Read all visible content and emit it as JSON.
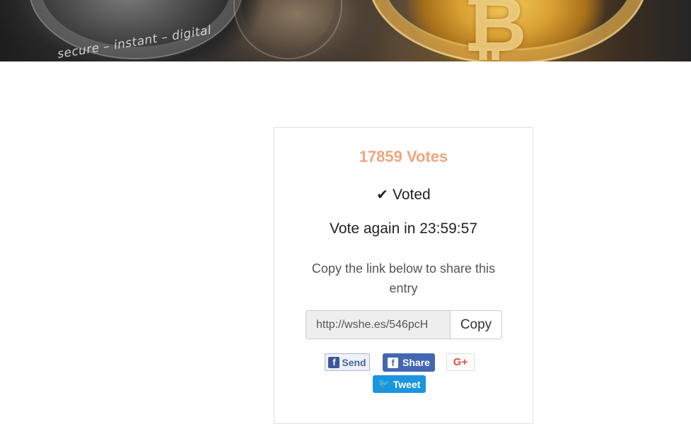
{
  "banner": {
    "coin_text": "secure – instant – digital"
  },
  "vote_card": {
    "votes": "17859 Votes",
    "voted_label": "Voted",
    "countdown": "Vote again in 23:59:57",
    "share_text": "Copy the link below to share this entry",
    "link_value": "http://wshe.es/546pcH",
    "copy_label": "Copy"
  },
  "social": {
    "fb_send_label": "Send",
    "fb_share_label": "Share",
    "gplus_label": "G+",
    "tweet_label": "Tweet"
  },
  "colors": {
    "votes_accent": "#f1a47f",
    "facebook": "#4267b2",
    "twitter": "#1b95e0",
    "google_plus": "#dc4e41"
  },
  "icons": [
    "check-icon",
    "facebook-icon",
    "google-plus-icon",
    "twitter-bird-icon"
  ]
}
